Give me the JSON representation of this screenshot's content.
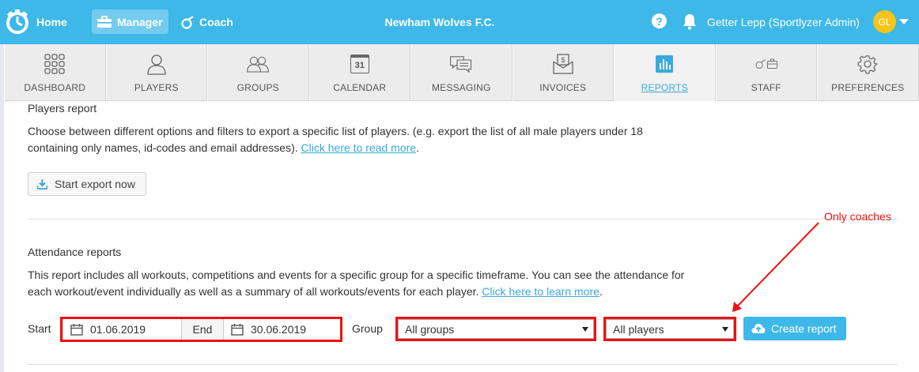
{
  "topbar": {
    "home_label": "Home",
    "manager_label": "Manager",
    "coach_label": "Coach",
    "club_name": "Newham Wolves F.C.",
    "help_symbol": "?",
    "user_name": "Getter Lepp (Sportlyzer Admin)",
    "avatar_initials": "GL",
    "bar_color": "#3db8e8",
    "avatar_color": "#f6c51b"
  },
  "nav": {
    "tabs": [
      {
        "label": "DASHBOARD",
        "icon": "grid-icon"
      },
      {
        "label": "PLAYERS",
        "icon": "person-icon"
      },
      {
        "label": "GROUPS",
        "icon": "people-icon"
      },
      {
        "label": "CALENDAR",
        "icon": "calendar-icon",
        "icon_text": "31"
      },
      {
        "label": "MESSAGING",
        "icon": "chat-icon"
      },
      {
        "label": "INVOICES",
        "icon": "invoice-icon"
      },
      {
        "label": "REPORTS",
        "icon": "bar-chart-icon",
        "active": true
      },
      {
        "label": "STAFF",
        "icon": "whistle-briefcase-icon"
      },
      {
        "label": "PREFERENCES",
        "icon": "gear-icon"
      }
    ]
  },
  "players_report": {
    "title": "Players report",
    "description_line1": "Choose between different options and filters to export a specific list of players. (e.g. export the list of all male players under 18",
    "description_line2": "containing only names, id-codes and email addresses).",
    "link_text": "Click here to read more",
    "link_suffix": ".",
    "export_button": "Start export now"
  },
  "attendance_report": {
    "title": "Attendance reports",
    "description_line1": "This report includes all workouts, competitions and events for a specific group for a specific timeframe. You can see the attendance for",
    "description_line2": "each workout/event individually as well as a summary of all workouts/events for each player.",
    "link_text": "Click here to learn more",
    "link_suffix": ".",
    "start_label": "Start",
    "start_date": "01.06.2019",
    "end_label": "End",
    "end_date": "30.06.2019",
    "group_label": "Group",
    "group_select": "All groups",
    "players_select": "All players",
    "create_button": "Create report"
  },
  "annotation": {
    "note": "Only coaches",
    "color": "#e11111"
  }
}
